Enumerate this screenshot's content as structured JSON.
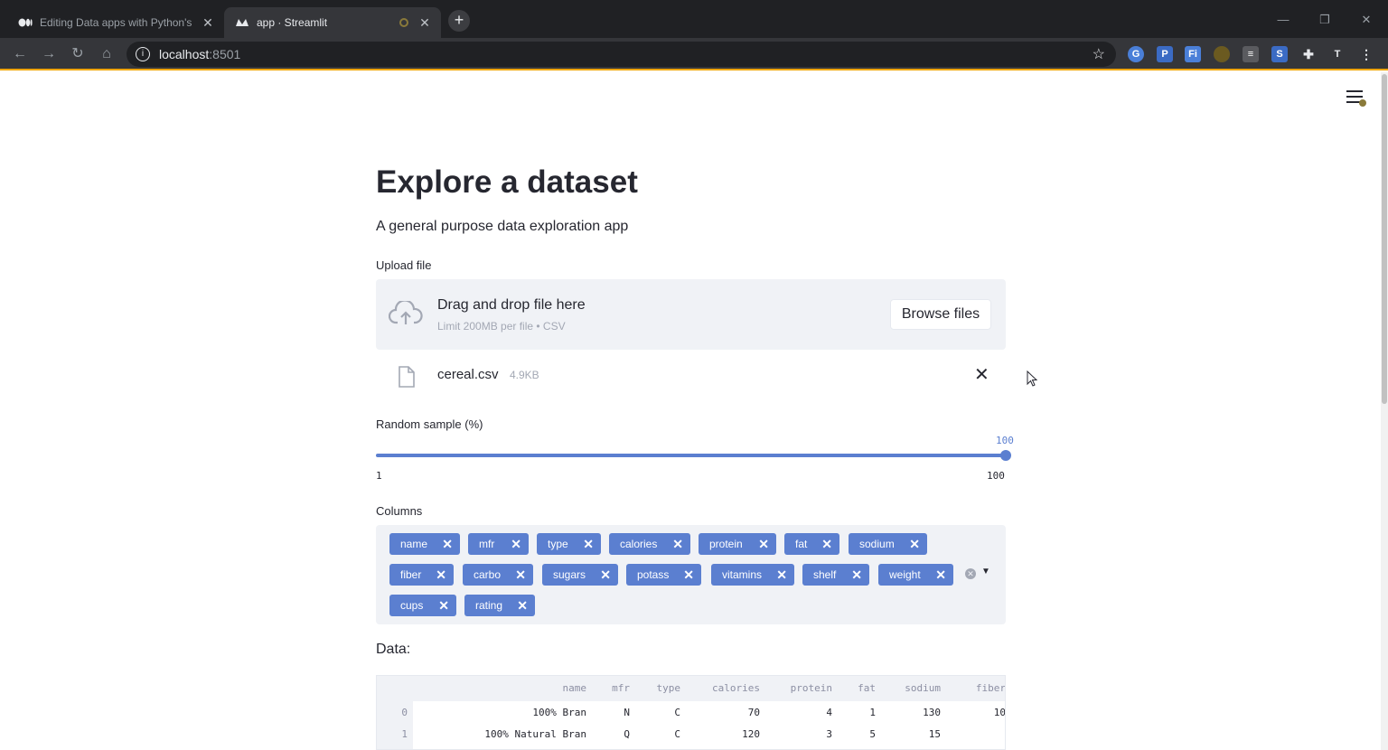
{
  "browser": {
    "tabs": [
      {
        "title": "Editing Data apps with Python's",
        "close": "✕"
      },
      {
        "title": "app · Streamlit",
        "close": "✕"
      }
    ],
    "new_tab": "+",
    "url_host": "localhost",
    "url_port": ":8501",
    "window_controls": [
      "—",
      "❐",
      "✕"
    ]
  },
  "app": {
    "title": "Explore a dataset",
    "subtitle": "A general purpose data exploration app",
    "upload_label": "Upload file",
    "dropzone_title": "Drag and drop file here",
    "dropzone_limit": "Limit 200MB per file • CSV",
    "browse_label": "Browse files",
    "file_name": "cereal.csv",
    "file_size": "4.9KB",
    "slider_label": "Random sample (%)",
    "slider_value": "100",
    "slider_min": "1",
    "slider_max": "100",
    "columns_label": "Columns",
    "columns": [
      "name",
      "mfr",
      "type",
      "calories",
      "protein",
      "fat",
      "sodium",
      "fiber",
      "carbo",
      "sugars",
      "potass",
      "vitamins",
      "shelf",
      "weight",
      "cups",
      "rating"
    ],
    "data_label": "Data:",
    "table": {
      "headers": [
        "name",
        "mfr",
        "type",
        "calories",
        "protein",
        "fat",
        "sodium",
        "fiber"
      ],
      "rows": [
        {
          "index": "0",
          "cells": [
            "100% Bran",
            "N",
            "C",
            "70",
            "4",
            "1",
            "130",
            "10"
          ]
        },
        {
          "index": "1",
          "cells": [
            "100% Natural Bran",
            "Q",
            "C",
            "120",
            "3",
            "5",
            "15",
            ""
          ]
        }
      ]
    }
  },
  "colors": {
    "accent": "#5b7fd0",
    "widget_bg": "#f0f2f6",
    "text": "#262730"
  }
}
